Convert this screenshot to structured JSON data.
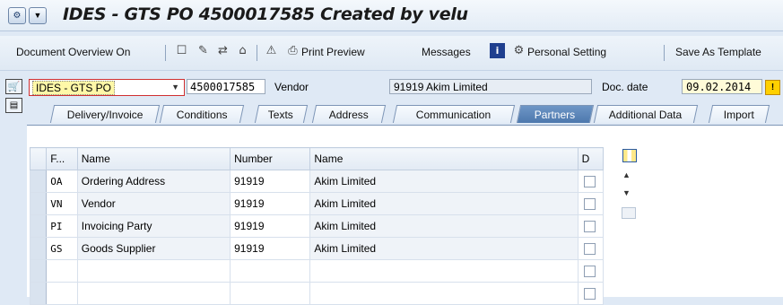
{
  "title": {
    "text": "IDES - GTS PO 4500017585 Created by velu"
  },
  "toolbar": {
    "document_overview": "Document Overview On",
    "print_preview": "Print Preview",
    "messages": "Messages",
    "personal_setting": "Personal Setting",
    "save_as_template": "Save As Template"
  },
  "header": {
    "doc_type": "IDES - GTS PO",
    "po_number": "4500017585",
    "vendor_label": "Vendor",
    "vendor_value": "91919 Akim Limited",
    "doc_date_label": "Doc. date",
    "doc_date_value": "09.02.2014"
  },
  "tabs": [
    {
      "label": "Delivery/Invoice"
    },
    {
      "label": "Conditions"
    },
    {
      "label": "Texts"
    },
    {
      "label": "Address"
    },
    {
      "label": "Communication"
    },
    {
      "label": "Partners",
      "active": true
    },
    {
      "label": "Additional Data"
    },
    {
      "label": "Import"
    }
  ],
  "partners": {
    "headers": {
      "func": "F...",
      "name": "Name",
      "number": "Number",
      "name2": "Name",
      "d": "D"
    },
    "rows": [
      {
        "func": "OA",
        "name": "Ordering Address",
        "number": "91919",
        "partner": "Akim Limited"
      },
      {
        "func": "VN",
        "name": "Vendor",
        "number": "91919",
        "partner": "Akim Limited"
      },
      {
        "func": "PI",
        "name": "Invoicing Party",
        "number": "91919",
        "partner": "Akim Limited"
      },
      {
        "func": "GS",
        "name": "Goods Supplier",
        "number": "91919",
        "partner": "Akim Limited"
      },
      {
        "func": "",
        "name": "",
        "number": "",
        "partner": ""
      },
      {
        "func": "",
        "name": "",
        "number": "",
        "partner": ""
      }
    ]
  },
  "colors": {
    "active_tab": "#5a83b8",
    "required_field": "#fff8a8",
    "warning": "#ffd000"
  }
}
